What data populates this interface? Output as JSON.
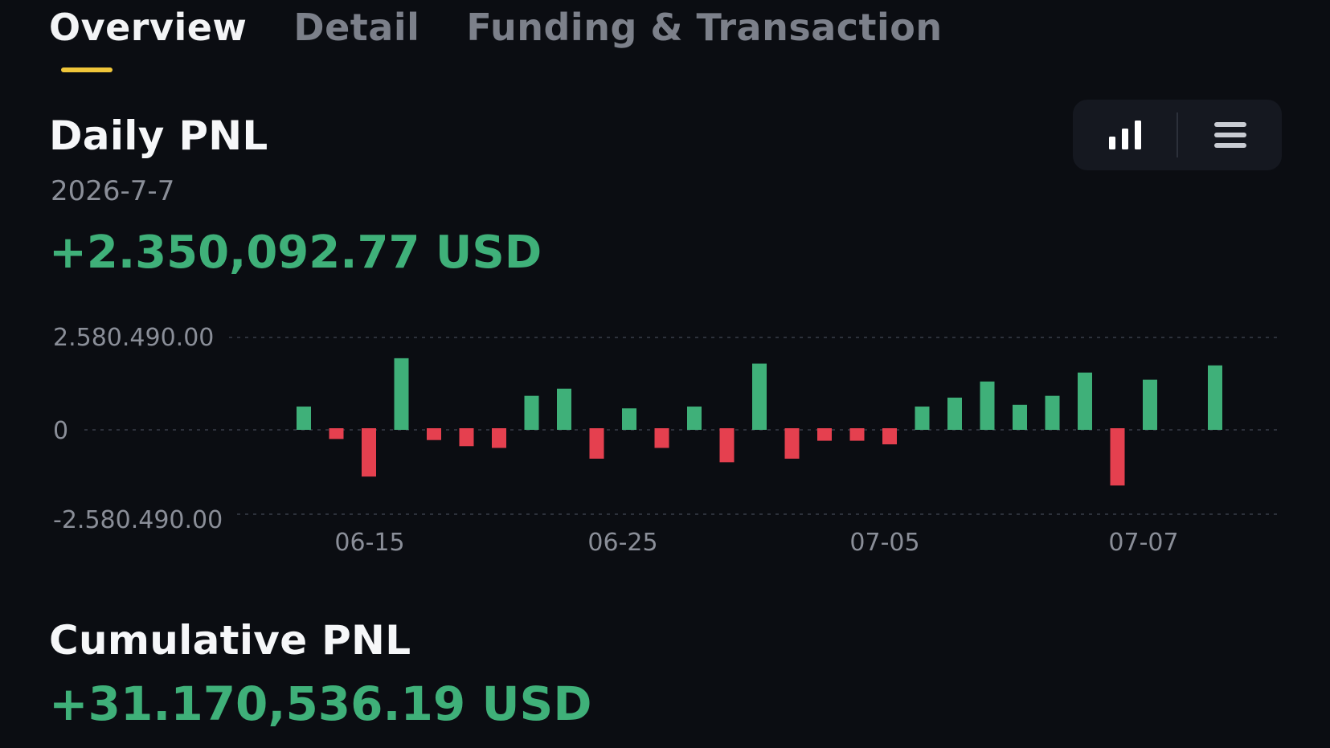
{
  "tabs": [
    {
      "label": "Overview",
      "active": true
    },
    {
      "label": "Detail",
      "active": false
    },
    {
      "label": "Funding & Transaction",
      "active": false
    }
  ],
  "daily": {
    "title": "Daily PNL",
    "date": "2026-7-7",
    "value": "+2.350,092.77 USD"
  },
  "view_toggle": {
    "selected": "chart",
    "icons": [
      "bar-chart-icon",
      "list-icon"
    ]
  },
  "cumulative": {
    "title": "Cumulative PNL",
    "value": "+31.170,536.19 USD"
  },
  "colors": {
    "positive": "#3fb079",
    "negative": "#e5404f",
    "accent": "#f0c63a",
    "background": "#0b0d12"
  },
  "chart_data": {
    "type": "bar",
    "ylim": [
      -2580490,
      2580490
    ],
    "y_tick_labels": [
      "2.580.490.00",
      "0",
      "-2.580.490.00"
    ],
    "x_tick_labels": [
      "06-15",
      "06-25",
      "07-05",
      "07-07"
    ],
    "values": [
      650000,
      -300000,
      -1350000,
      2000000,
      -330000,
      -500000,
      -550000,
      950000,
      1150000,
      -850000,
      600000,
      -550000,
      650000,
      -950000,
      1850000,
      -850000,
      -350000,
      -350000,
      -450000,
      650000,
      900000,
      1350000,
      700000,
      950000,
      1600000,
      -1600000,
      1400000,
      0,
      1800000
    ],
    "grid": true,
    "legend": "none"
  }
}
